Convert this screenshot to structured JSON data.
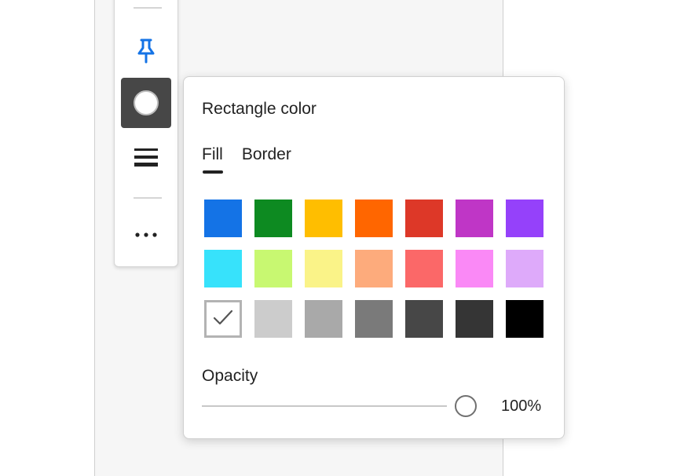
{
  "toolbar": {
    "items": [
      {
        "name": "pin-icon",
        "color": "#1473e6"
      },
      {
        "name": "fill-color-button",
        "active": true
      },
      {
        "name": "stroke-width-icon"
      },
      {
        "name": "more-icon"
      }
    ]
  },
  "popover": {
    "title": "Rectangle color",
    "tabs": [
      {
        "label": "Fill",
        "selected": true
      },
      {
        "label": "Border",
        "selected": false
      }
    ],
    "swatches": [
      [
        "#1473e6",
        "#0d8a21",
        "#ffbe00",
        "#ff6600",
        "#dd3828",
        "#bf36c6",
        "#9541fa"
      ],
      [
        "#37e2fb",
        "#c8f871",
        "#faf388",
        "#fdab7c",
        "#fb6868",
        "#fa89f6",
        "#deaafa"
      ],
      [
        "#ffffff",
        "#cccccc",
        "#a9a9a9",
        "#7a7a7a",
        "#474747",
        "#353535",
        "#000000"
      ]
    ],
    "selected_swatch": "#ffffff",
    "opacity_label": "Opacity",
    "opacity_value": "100%",
    "opacity_fraction": 1.0
  }
}
